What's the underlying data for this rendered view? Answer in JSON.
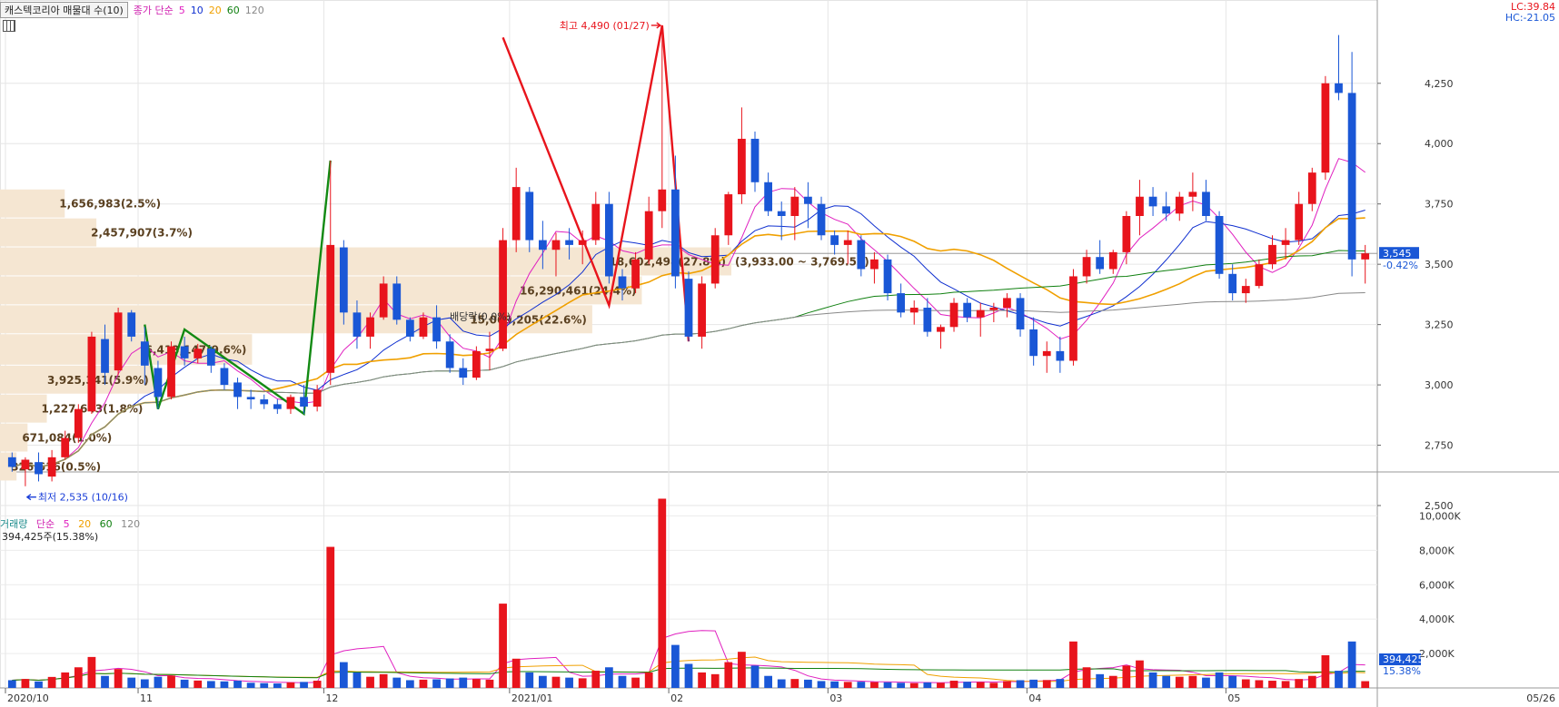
{
  "legend": {
    "title": "캐스텍코리아 매물대 수(10)",
    "ma_prefix": "종가 단순",
    "ma_items": [
      {
        "label": "5",
        "color": "#e020c0"
      },
      {
        "label": "10",
        "color": "#1030d0"
      },
      {
        "label": "20",
        "color": "#f0a000"
      },
      {
        "label": "60",
        "color": "#108010"
      },
      {
        "label": "120",
        "color": "#888888"
      }
    ]
  },
  "lc": "LC:39.84",
  "hc": "HC:-21.05",
  "volume_legend": {
    "title": "거래량",
    "ma_prefix": "단순",
    "items": [
      {
        "label": "5",
        "color": "#e020c0"
      },
      {
        "label": "20",
        "color": "#f0a000"
      },
      {
        "label": "60",
        "color": "#108010"
      },
      {
        "label": "120",
        "color": "#888888"
      }
    ],
    "current": "394,425주(15.38%)"
  },
  "colors": {
    "up": "#e8141c",
    "down": "#1a57d6",
    "vp": "#f5e6d2",
    "zigzag_up": "#138a13",
    "zigzag_hi": "#e8141c"
  },
  "chart_data": {
    "type": "candlestick",
    "price_axis": {
      "ticks": [
        "2,500",
        "2,750",
        "3,000",
        "3,250",
        "3,500",
        "3,750",
        "4,000",
        "4,250"
      ],
      "ylim": [
        2470,
        4520
      ],
      "current_price": "3,545",
      "current_change": "-0.42%"
    },
    "volume_axis": {
      "ticks": [
        "2,000K",
        "4,000K",
        "6,000K",
        "8,000K",
        "10,000K"
      ],
      "ylim": [
        0,
        11500
      ],
      "current_volume": "394,425",
      "current_ratio": "15.38%"
    },
    "x_labels": [
      {
        "label": "2020/10",
        "index": 0
      },
      {
        "label": "11",
        "index": 10
      },
      {
        "label": "12",
        "index": 24
      },
      {
        "label": "2021/01",
        "index": 38
      },
      {
        "label": "02",
        "index": 50
      },
      {
        "label": "03",
        "index": 62
      },
      {
        "label": "04",
        "index": 77
      },
      {
        "label": "05",
        "index": 92
      }
    ],
    "date_right": "05/26",
    "annotations": [
      {
        "text": "최고 4,490 (01/27)",
        "index": 49,
        "value": 4490,
        "color": "#e8141c",
        "arrow": "right"
      },
      {
        "text": "최저 2,535 (10/16)",
        "index": 1,
        "value": 2535,
        "color": "#1a3ed8",
        "arrow": "left"
      },
      {
        "text": "배당락(0.0%)",
        "index": 33,
        "value": 3270,
        "color": "#333333",
        "arrow": "none"
      }
    ],
    "volume_profile": [
      {
        "low": 2600,
        "high": 2720,
        "label": "326,616(0.5%)",
        "width": 0.012
      },
      {
        "low": 2720,
        "high": 2840,
        "label": "671,084(1.0%)",
        "width": 0.02
      },
      {
        "low": 2840,
        "high": 2960,
        "label": "1,227,643(1.8%)",
        "width": 0.034
      },
      {
        "low": 2960,
        "high": 3080,
        "label": "3,925,341(5.9%)",
        "width": 0.112
      },
      {
        "low": 3080,
        "high": 3210,
        "label": "6,413,147(9.6%)",
        "width": 0.183
      },
      {
        "low": 3210,
        "high": 3330,
        "label": "15,069,205(22.6%)",
        "width": 0.43
      },
      {
        "low": 3330,
        "high": 3450,
        "label": "16,290,461(24.4%)",
        "width": 0.466
      },
      {
        "low": 3450,
        "high": 3570,
        "label": "18,602,498(27.8%)",
        "width": 0.531
      },
      {
        "low": 3570,
        "high": 3690,
        "label": "2,457,907(3.7%)",
        "width": 0.07
      },
      {
        "low": 3690,
        "high": 3810,
        "label": "1,656,983(2.5%)",
        "width": 0.047
      }
    ],
    "vp_range_label": "(3,933.00 ~ 3,769.50)",
    "candles": [
      [
        2700,
        2720,
        2640,
        2660,
        450
      ],
      [
        2650,
        2700,
        2580,
        2690,
        520
      ],
      [
        2680,
        2720,
        2600,
        2630,
        380
      ],
      [
        2620,
        2730,
        2600,
        2700,
        640
      ],
      [
        2700,
        2810,
        2690,
        2780,
        900
      ],
      [
        2780,
        2920,
        2760,
        2900,
        1200
      ],
      [
        2890,
        3220,
        2880,
        3200,
        1800
      ],
      [
        3190,
        3250,
        3000,
        3050,
        700
      ],
      [
        3060,
        3320,
        3040,
        3300,
        1100
      ],
      [
        3300,
        3310,
        3180,
        3200,
        600
      ],
      [
        3180,
        3240,
        3000,
        3080,
        500
      ],
      [
        3070,
        3100,
        2900,
        2950,
        650
      ],
      [
        2950,
        3180,
        2940,
        3160,
        720
      ],
      [
        3160,
        3200,
        3080,
        3110,
        480
      ],
      [
        3110,
        3170,
        3090,
        3150,
        430
      ],
      [
        3150,
        3160,
        3050,
        3080,
        400
      ],
      [
        3070,
        3090,
        2980,
        3000,
        380
      ],
      [
        3010,
        3030,
        2900,
        2950,
        420
      ],
      [
        2950,
        2980,
        2900,
        2940,
        300
      ],
      [
        2940,
        2960,
        2900,
        2920,
        280
      ],
      [
        2920,
        2940,
        2880,
        2900,
        260
      ],
      [
        2900,
        2960,
        2880,
        2950,
        320
      ],
      [
        2950,
        3000,
        2880,
        2910,
        350
      ],
      [
        2910,
        3000,
        2890,
        2980,
        420
      ],
      [
        3050,
        3930,
        3000,
        3580,
        8200
      ],
      [
        3570,
        3600,
        3250,
        3300,
        1500
      ],
      [
        3300,
        3350,
        3150,
        3200,
        900
      ],
      [
        3200,
        3300,
        3150,
        3280,
        650
      ],
      [
        3280,
        3450,
        3270,
        3420,
        800
      ],
      [
        3420,
        3450,
        3250,
        3270,
        600
      ],
      [
        3270,
        3280,
        3180,
        3200,
        450
      ],
      [
        3200,
        3300,
        3190,
        3280,
        480
      ],
      [
        3280,
        3330,
        3150,
        3180,
        500
      ],
      [
        3180,
        3210,
        3050,
        3070,
        550
      ],
      [
        3070,
        3110,
        3000,
        3030,
        600
      ],
      [
        3030,
        3160,
        3020,
        3140,
        520
      ],
      [
        3140,
        3220,
        3060,
        3150,
        480
      ],
      [
        3150,
        3650,
        3140,
        3600,
        4900
      ],
      [
        3600,
        3900,
        3550,
        3820,
        1700
      ],
      [
        3800,
        3820,
        3550,
        3600,
        900
      ],
      [
        3600,
        3680,
        3480,
        3560,
        700
      ],
      [
        3560,
        3630,
        3450,
        3600,
        650
      ],
      [
        3600,
        3650,
        3520,
        3580,
        600
      ],
      [
        3580,
        3640,
        3500,
        3600,
        560
      ],
      [
        3600,
        3800,
        3580,
        3750,
        1000
      ],
      [
        3750,
        3800,
        3420,
        3450,
        1200
      ],
      [
        3450,
        3480,
        3350,
        3400,
        700
      ],
      [
        3400,
        3550,
        3380,
        3520,
        600
      ],
      [
        3520,
        3780,
        3500,
        3720,
        900
      ],
      [
        3720,
        4490,
        3650,
        3810,
        11000
      ],
      [
        3810,
        3950,
        3400,
        3450,
        2500
      ],
      [
        3440,
        3470,
        3180,
        3200,
        1400
      ],
      [
        3200,
        3450,
        3150,
        3420,
        900
      ],
      [
        3420,
        3650,
        3400,
        3620,
        800
      ],
      [
        3620,
        3800,
        3580,
        3790,
        1500
      ],
      [
        3790,
        4150,
        3750,
        4020,
        2100
      ],
      [
        4020,
        4050,
        3800,
        3840,
        1300
      ],
      [
        3840,
        3880,
        3700,
        3720,
        700
      ],
      [
        3720,
        3760,
        3600,
        3700,
        500
      ],
      [
        3700,
        3820,
        3600,
        3780,
        520
      ],
      [
        3780,
        3840,
        3650,
        3750,
        480
      ],
      [
        3750,
        3780,
        3600,
        3620,
        400
      ],
      [
        3620,
        3640,
        3540,
        3580,
        380
      ],
      [
        3580,
        3640,
        3500,
        3600,
        350
      ],
      [
        3600,
        3620,
        3450,
        3480,
        360
      ],
      [
        3480,
        3550,
        3420,
        3520,
        340
      ],
      [
        3520,
        3540,
        3350,
        3380,
        330
      ],
      [
        3380,
        3420,
        3280,
        3300,
        300
      ],
      [
        3300,
        3350,
        3250,
        3320,
        280
      ],
      [
        3320,
        3360,
        3200,
        3220,
        320
      ],
      [
        3220,
        3250,
        3150,
        3240,
        300
      ],
      [
        3240,
        3360,
        3220,
        3340,
        420
      ],
      [
        3340,
        3360,
        3260,
        3280,
        360
      ],
      [
        3280,
        3340,
        3200,
        3310,
        340
      ],
      [
        3310,
        3340,
        3260,
        3320,
        300
      ],
      [
        3320,
        3380,
        3280,
        3360,
        400
      ],
      [
        3360,
        3380,
        3200,
        3230,
        450
      ],
      [
        3230,
        3280,
        3080,
        3120,
        480
      ],
      [
        3120,
        3180,
        3050,
        3140,
        460
      ],
      [
        3140,
        3200,
        3050,
        3100,
        520
      ],
      [
        3100,
        3480,
        3080,
        3450,
        2700
      ],
      [
        3450,
        3560,
        3420,
        3530,
        1200
      ],
      [
        3530,
        3600,
        3460,
        3480,
        800
      ],
      [
        3480,
        3560,
        3460,
        3550,
        700
      ],
      [
        3550,
        3720,
        3500,
        3700,
        1300
      ],
      [
        3700,
        3850,
        3620,
        3780,
        1600
      ],
      [
        3780,
        3820,
        3700,
        3740,
        900
      ],
      [
        3740,
        3800,
        3680,
        3710,
        700
      ],
      [
        3710,
        3800,
        3680,
        3780,
        650
      ],
      [
        3780,
        3880,
        3720,
        3800,
        700
      ],
      [
        3800,
        3850,
        3680,
        3700,
        600
      ],
      [
        3700,
        3720,
        3440,
        3460,
        900
      ],
      [
        3460,
        3500,
        3350,
        3380,
        700
      ],
      [
        3380,
        3440,
        3340,
        3410,
        500
      ],
      [
        3410,
        3520,
        3400,
        3500,
        450
      ],
      [
        3500,
        3620,
        3480,
        3580,
        420
      ],
      [
        3580,
        3650,
        3520,
        3600,
        400
      ],
      [
        3600,
        3800,
        3580,
        3750,
        520
      ],
      [
        3750,
        3900,
        3720,
        3880,
        700
      ],
      [
        3880,
        4280,
        3850,
        4250,
        1900
      ],
      [
        4250,
        4450,
        4180,
        4210,
        1000
      ],
      [
        4210,
        4380,
        3450,
        3520,
        2700
      ],
      [
        3520,
        3580,
        3420,
        3545,
        394
      ]
    ]
  }
}
